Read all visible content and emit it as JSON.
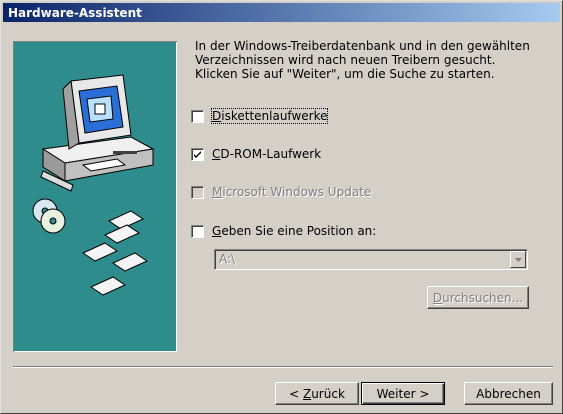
{
  "window": {
    "title": "Hardware-Assistent"
  },
  "intro_lines": [
    "In der Windows-Treiberdatenbank und in den gewählten",
    "Verzeichnissen wird nach neuen Treibern gesucht.",
    "Klicken Sie auf \"Weiter\", um die Suche zu starten."
  ],
  "options": {
    "floppy": {
      "key": "D",
      "rest": "iskettenlaufwerke",
      "checked": false,
      "enabled": true
    },
    "cdrom": {
      "key": "C",
      "rest": "D-ROM-Laufwerk",
      "checked": true,
      "enabled": true
    },
    "winupdate": {
      "key": "M",
      "rest": "icrosoft Windows Update",
      "checked": false,
      "enabled": false
    },
    "location": {
      "key": "G",
      "rest": "eben Sie eine Position an:",
      "checked": false,
      "enabled": true
    }
  },
  "location_combo": {
    "value": "A:\\"
  },
  "buttons": {
    "browse": {
      "key": "D",
      "rest": "urchsuchen..."
    },
    "back": {
      "prefix": "< ",
      "key": "Z",
      "rest": "urück"
    },
    "next": {
      "label": "Weiter >"
    },
    "cancel": {
      "label": "Abbrechen"
    }
  },
  "icons": {
    "illustration": "hardware-search-illustration-icon",
    "check": "checkmark-icon",
    "dropdown": "dropdown-arrow-icon"
  },
  "colors": {
    "title_start": "#0a246a",
    "title_end": "#a6caf0",
    "face": "#d4d0c8",
    "illustration_bg": "#2e8c8c"
  }
}
